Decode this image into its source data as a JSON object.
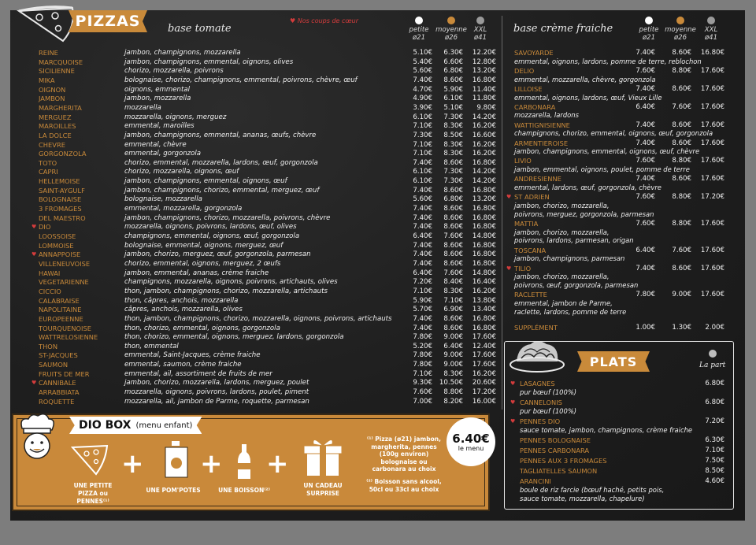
{
  "pizzas": {
    "title": "PIZZAS",
    "base": "base tomate",
    "favorites_label": "Nos coups de cœur",
    "sizes": [
      {
        "name": "petite",
        "diam": "ø21",
        "color": "#ffffff"
      },
      {
        "name": "moyenne",
        "diam": "ø26",
        "color": "#c98a3a"
      },
      {
        "name": "XXL",
        "diam": "ø41",
        "color": "#9a9a9a"
      }
    ],
    "items": [
      {
        "name": "REINE",
        "desc": "jambon, champignons, mozzarella",
        "p": [
          "5.10€",
          "6.30€",
          "12.20€"
        ],
        "fav": false
      },
      {
        "name": "MARCQUOISE",
        "desc": "jambon, champignons, emmental, oignons, olives",
        "p": [
          "5.40€",
          "6.60€",
          "12.80€"
        ],
        "fav": false
      },
      {
        "name": "SICILIENNE",
        "desc": "chorizo, mozzarella, poivrons",
        "p": [
          "5.60€",
          "6.80€",
          "13.20€"
        ],
        "fav": false
      },
      {
        "name": "MIKA",
        "desc": "bolognaise, chorizo, champignons, emmental, poivrons, chèvre, œuf",
        "p": [
          "7.40€",
          "8.60€",
          "16.80€"
        ],
        "fav": false
      },
      {
        "name": "OIGNON",
        "desc": "oignons, emmental",
        "p": [
          "4.70€",
          "5.90€",
          "11.40€"
        ],
        "fav": false
      },
      {
        "name": "JAMBON",
        "desc": "jambon, mozzarella",
        "p": [
          "4.90€",
          "6.10€",
          "11.80€"
        ],
        "fav": false
      },
      {
        "name": "MARGHERITA",
        "desc": "mozzarella",
        "p": [
          "3.90€",
          "5.10€",
          "9.80€"
        ],
        "fav": false
      },
      {
        "name": "MERGUEZ",
        "desc": "mozzarella, oignons, merguez",
        "p": [
          "6.10€",
          "7.30€",
          "14.20€"
        ],
        "fav": false
      },
      {
        "name": "MAROILLES",
        "desc": "emmental, maroilles",
        "p": [
          "7.10€",
          "8.30€",
          "16.20€"
        ],
        "fav": false
      },
      {
        "name": "LA DOLCE",
        "desc": "jambon, champignons, emmental, ananas, œufs, chèvre",
        "p": [
          "7.30€",
          "8.50€",
          "16.60€"
        ],
        "fav": false
      },
      {
        "name": "CHEVRE",
        "desc": "emmental, chèvre",
        "p": [
          "7.10€",
          "8.30€",
          "16.20€"
        ],
        "fav": false
      },
      {
        "name": "GORGONZOLA",
        "desc": "emmental, gorgonzola",
        "p": [
          "7.10€",
          "8.30€",
          "16.20€"
        ],
        "fav": false
      },
      {
        "name": "TOTO",
        "desc": "chorizo, emmental, mozzarella, lardons, œuf, gorgonzola",
        "p": [
          "7.40€",
          "8.60€",
          "16.80€"
        ],
        "fav": false
      },
      {
        "name": "CAPRI",
        "desc": "chorizo, mozzarella, oignons, œuf",
        "p": [
          "6.10€",
          "7.30€",
          "14.20€"
        ],
        "fav": false
      },
      {
        "name": "HELLEMOISE",
        "desc": "jambon, champignons, emmental, oignons, œuf",
        "p": [
          "6.10€",
          "7.30€",
          "14.20€"
        ],
        "fav": false
      },
      {
        "name": "SAINT-AYGULF",
        "desc": "jambon, champignons, chorizo, emmental, merguez, œuf",
        "p": [
          "7.40€",
          "8.60€",
          "16.80€"
        ],
        "fav": false
      },
      {
        "name": "BOLOGNAISE",
        "desc": "bolognaise, mozzarella",
        "p": [
          "5.60€",
          "6.80€",
          "13.20€"
        ],
        "fav": false
      },
      {
        "name": "3 FROMAGES",
        "desc": "emmental, mozzarella, gorgonzola",
        "p": [
          "7.40€",
          "8.60€",
          "16.80€"
        ],
        "fav": false
      },
      {
        "name": "DEL MAESTRO",
        "desc": "jambon, champignons, chorizo, mozzarella, poivrons, chèvre",
        "p": [
          "7.40€",
          "8.60€",
          "16.80€"
        ],
        "fav": false
      },
      {
        "name": "DIO",
        "desc": "mozzarella, oignons, poivrons, lardons, œuf, olives",
        "p": [
          "7.40€",
          "8.60€",
          "16.80€"
        ],
        "fav": true
      },
      {
        "name": "LOOSSOISE",
        "desc": "champignons, emmental, oignons, œuf, gorgonzola",
        "p": [
          "6.40€",
          "7.60€",
          "14.80€"
        ],
        "fav": false
      },
      {
        "name": "LOMMOISE",
        "desc": "bolognaise, emmental, oignons, merguez, œuf",
        "p": [
          "7.40€",
          "8.60€",
          "16.80€"
        ],
        "fav": false
      },
      {
        "name": "ANNAPPOISE",
        "desc": "jambon, chorizo, merguez, œuf, gorgonzola, parmesan",
        "p": [
          "7.40€",
          "8.60€",
          "16.80€"
        ],
        "fav": true
      },
      {
        "name": "VILLENEUVOISE",
        "desc": "chorizo, emmental, oignons, merguez, 2 œufs",
        "p": [
          "7.40€",
          "8.60€",
          "16.80€"
        ],
        "fav": false
      },
      {
        "name": "HAWAI",
        "desc": "jambon, emmental, ananas, crème fraiche",
        "p": [
          "6.40€",
          "7.60€",
          "14.80€"
        ],
        "fav": false
      },
      {
        "name": "VEGETARIENNE",
        "desc": "champignons, mozzarella, oignons, poivrons, artichauts, olives",
        "p": [
          "7.20€",
          "8.40€",
          "16.40€"
        ],
        "fav": false
      },
      {
        "name": "CICCIO",
        "desc": "thon, jambon, champignons, chorizo, mozzarella, artichauts",
        "p": [
          "7.10€",
          "8.30€",
          "16.20€"
        ],
        "fav": false
      },
      {
        "name": "CALABRAISE",
        "desc": "thon, câpres, anchois, mozzarella",
        "p": [
          "5.90€",
          "7.10€",
          "13.80€"
        ],
        "fav": false
      },
      {
        "name": "NAPOLITAINE",
        "desc": "câpres, anchois, mozzarella, olives",
        "p": [
          "5.70€",
          "6.90€",
          "13.40€"
        ],
        "fav": false
      },
      {
        "name": "EUROPEENNE",
        "desc": "thon, jambon, champignons, chorizo, mozzarella, oignons, poivrons, artichauts",
        "p": [
          "7.40€",
          "8.60€",
          "16.80€"
        ],
        "fav": false
      },
      {
        "name": "TOURQUENOISE",
        "desc": "thon, chorizo, emmental, oignons, gorgonzola",
        "p": [
          "7.40€",
          "8.60€",
          "16.80€"
        ],
        "fav": false
      },
      {
        "name": "WATTRELOSIENNE",
        "desc": "thon, chorizo, emmental, oignons, merguez, lardons, gorgonzola",
        "p": [
          "7.80€",
          "9.00€",
          "17.60€"
        ],
        "fav": false
      },
      {
        "name": "THON",
        "desc": "thon, emmental",
        "p": [
          "5.20€",
          "6.40€",
          "12.40€"
        ],
        "fav": false
      },
      {
        "name": "ST-JACQUES",
        "desc": "emmental, Saint-Jacques, crème fraiche",
        "p": [
          "7.80€",
          "9.00€",
          "17.60€"
        ],
        "fav": false
      },
      {
        "name": "SAUMON",
        "desc": "emmental, saumon, crème fraiche",
        "p": [
          "7.80€",
          "9.00€",
          "17.60€"
        ],
        "fav": false
      },
      {
        "name": "FRUITS DE MER",
        "desc": "emmental, ail, assortiment de fruits de mer",
        "p": [
          "7.10€",
          "8.30€",
          "16.20€"
        ],
        "fav": false
      },
      {
        "name": "CANNIBALE",
        "desc": "jambon, chorizo, mozzarella, lardons, merguez, poulet",
        "p": [
          "9.30€",
          "10.50€",
          "20.60€"
        ],
        "fav": true
      },
      {
        "name": "ARRABBIATA",
        "desc": "mozzarella, oignons, poivrons, lardons, poulet, piment",
        "p": [
          "7.60€",
          "8.80€",
          "17.20€"
        ],
        "fav": false
      },
      {
        "name": "ROQUETTE",
        "desc": "mozzarella, ail, jambon de Parme, roquette, parmesan",
        "p": [
          "7.00€",
          "8.20€",
          "16.00€"
        ],
        "fav": false
      }
    ]
  },
  "creme": {
    "base": "base crème fraiche",
    "sizes": [
      {
        "name": "petite",
        "diam": "ø21",
        "color": "#ffffff"
      },
      {
        "name": "moyenne",
        "diam": "ø26",
        "color": "#c98a3a"
      },
      {
        "name": "XXL",
        "diam": "ø41",
        "color": "#9a9a9a"
      }
    ],
    "items": [
      {
        "name": "SAVOYARDE",
        "desc": [
          "emmental, oignons, lardons, pomme de terre, reblochon"
        ],
        "p": [
          "7.40€",
          "8.60€",
          "16.80€"
        ],
        "fav": false
      },
      {
        "name": "DELIO",
        "desc": [
          "emmental, mozzarella, chèvre, gorgonzola"
        ],
        "p": [
          "7.60€",
          "8.80€",
          "17.60€"
        ],
        "fav": false
      },
      {
        "name": "LILLOISE",
        "desc": [
          "emmental, oignons, lardons, œuf, Vieux Lille"
        ],
        "p": [
          "7.40€",
          "8.60€",
          "17.60€"
        ],
        "fav": false
      },
      {
        "name": "CARBONARA",
        "desc": [
          "mozzarella, lardons"
        ],
        "p": [
          "6.40€",
          "7.60€",
          "17.60€"
        ],
        "fav": false
      },
      {
        "name": "WATTIGNISIENNE",
        "desc": [
          "champignons, chorizo, emmental, oignons, œuf, gorgonzola"
        ],
        "p": [
          "7.40€",
          "8.60€",
          "17.60€"
        ],
        "fav": false
      },
      {
        "name": "ARMENTIEROISE",
        "desc": [
          "jambon, champignons, emmental, oignons, œuf, chèvre"
        ],
        "p": [
          "7.40€",
          "8.60€",
          "17.60€"
        ],
        "fav": false
      },
      {
        "name": "LIVIO",
        "desc": [
          "jambon, emmental, oignons, poulet, pomme de terre"
        ],
        "p": [
          "7.60€",
          "8.80€",
          "17.60€"
        ],
        "fav": false
      },
      {
        "name": "ANDRESIENNE",
        "desc": [
          "emmental, lardons, œuf, gorgonzola, chèvre"
        ],
        "p": [
          "7.40€",
          "8.60€",
          "17.60€"
        ],
        "fav": false
      },
      {
        "name": "ST ADRIEN",
        "desc": [
          "jambon, chorizo, mozzarella,",
          "poivrons, merguez, gorgonzola, parmesan"
        ],
        "p": [
          "7.60€",
          "8.80€",
          "17.20€"
        ],
        "fav": true
      },
      {
        "name": "MATTIA",
        "desc": [
          "jambon, chorizo, mozzarella,",
          "poivrons, lardons, parmesan, origan"
        ],
        "p": [
          "7.60€",
          "8.80€",
          "17.60€"
        ],
        "fav": false
      },
      {
        "name": "TOSCANA",
        "desc": [
          "jambon, champignons, parmesan"
        ],
        "p": [
          "6.40€",
          "7.60€",
          "17.60€"
        ],
        "fav": false
      },
      {
        "name": "TILIO",
        "desc": [
          "jambon, chorizo, mozzarella,",
          "poivrons, œuf, gorgonzola, parmesan"
        ],
        "p": [
          "7.40€",
          "8.60€",
          "17.60€"
        ],
        "fav": true
      },
      {
        "name": "RACLETTE",
        "desc": [
          "emmental, jambon de Parme,",
          "raclette, lardons, pomme de terre"
        ],
        "p": [
          "7.80€",
          "9.00€",
          "17.60€"
        ],
        "fav": false
      }
    ],
    "supplement_label": "SUPPLÉMENT",
    "supplement": [
      "1.00€",
      "1.30€",
      "2.00€"
    ]
  },
  "plats": {
    "title": "PLATS",
    "unit_label": "La part",
    "items": [
      {
        "name": "LASAGNES",
        "desc": "pur bœuf (100%)",
        "price": "6.80€",
        "fav": true
      },
      {
        "name": "CANNELONIS",
        "desc": "pur bœuf (100%)",
        "price": "6.80€",
        "fav": true
      },
      {
        "name": "PENNES DIO",
        "desc": "sauce tomate, jambon, champignons, crème fraiche",
        "price": "7.20€",
        "fav": true
      },
      {
        "name": "PENNES BOLOGNAISE",
        "desc": "",
        "price": "6.30€",
        "fav": false
      },
      {
        "name": "PENNES CARBONARA",
        "desc": "",
        "price": "7.10€",
        "fav": false
      },
      {
        "name": "PENNES AUX 3 FROMAGES",
        "desc": "",
        "price": "7.50€",
        "fav": false
      },
      {
        "name": "TAGLIATELLES SAUMON",
        "desc": "",
        "price": "8.50€",
        "fav": false
      },
      {
        "name": "ARANCINI",
        "desc": "boule de riz farcie (bœuf haché, petits pois,\nsauce tomate, mozzarella, chapelure)",
        "price": "4.60€",
        "fav": false
      }
    ]
  },
  "diobox": {
    "title": "DIO BOX",
    "subtitle": "(menu enfant)",
    "price": "6.40€",
    "price_label": "le menu",
    "items": [
      "UNE PETITE\nPIZZA ou PENNES⁽¹⁾",
      "UNE POM'POTES",
      "UNE BOISSON⁽²⁾",
      "UN CADEAU\nSURPRISE"
    ],
    "note1": "⁽¹⁾ Pizza (ø21) jambon,\nmargherita, pennes\n(100g environ)\nbolognaise ou\ncarbonara au choix",
    "note2": "⁽²⁾ Boisson sans alcool,\n50cl ou 33cl au choix"
  }
}
